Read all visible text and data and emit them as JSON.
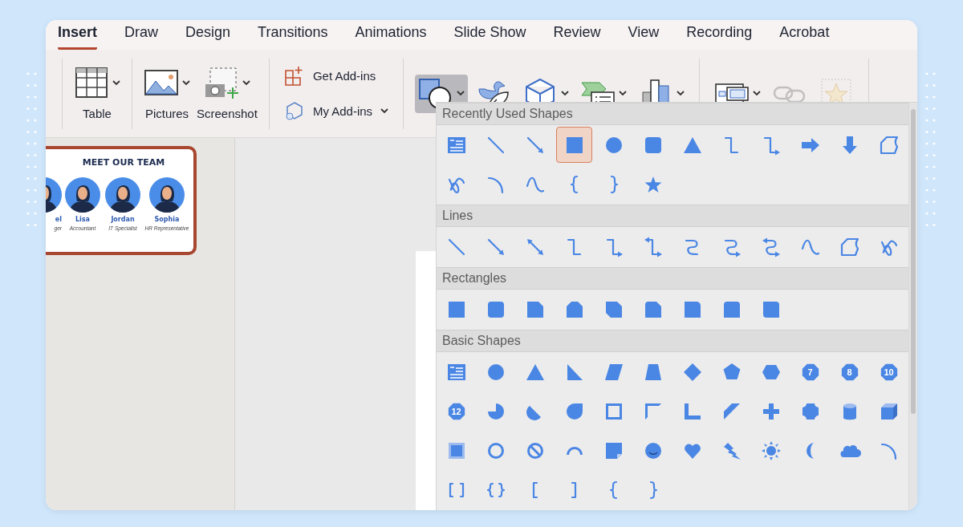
{
  "tabs": [
    {
      "label": "Insert",
      "selected": true
    },
    {
      "label": "Draw",
      "selected": false
    },
    {
      "label": "Design",
      "selected": false
    },
    {
      "label": "Transitions",
      "selected": false
    },
    {
      "label": "Animations",
      "selected": false
    },
    {
      "label": "Slide Show",
      "selected": false
    },
    {
      "label": "Review",
      "selected": false
    },
    {
      "label": "View",
      "selected": false
    },
    {
      "label": "Recording",
      "selected": false
    },
    {
      "label": "Acrobat",
      "selected": false
    }
  ],
  "ribbon": {
    "media_buttons": [
      {
        "kind": "table",
        "label": "Table",
        "menu": true
      },
      {
        "kind": "pictures",
        "label": "Pictures",
        "menu": true
      },
      {
        "kind": "screenshot",
        "label": "Screenshot",
        "menu": true
      }
    ],
    "addins": [
      {
        "kind": "get-addins",
        "label": "Get Add-ins",
        "menu": false
      },
      {
        "kind": "my-addins",
        "label": "My Add-ins",
        "menu": true
      }
    ],
    "tools": [
      {
        "kind": "shapes",
        "menu": true,
        "pressed": true,
        "disabled": false
      },
      {
        "kind": "icons",
        "menu": false,
        "pressed": false,
        "disabled": false
      },
      {
        "kind": "cube",
        "menu": true,
        "pressed": false,
        "disabled": false
      },
      {
        "kind": "smartart",
        "menu": true,
        "pressed": false,
        "disabled": false
      },
      {
        "kind": "chart",
        "menu": true,
        "pressed": false,
        "disabled": false
      }
    ],
    "links": [
      {
        "kind": "video",
        "menu": true,
        "pressed": false,
        "disabled": false
      },
      {
        "kind": "link",
        "menu": false,
        "pressed": false,
        "disabled": true
      },
      {
        "kind": "action",
        "menu": false,
        "pressed": false,
        "disabled": true
      }
    ]
  },
  "slide_thumbnail": {
    "selected": true,
    "title": "MEET OUR TEAM",
    "members": [
      {
        "name": "el",
        "role": "ger"
      },
      {
        "name": "Lisa",
        "role": "Accountant"
      },
      {
        "name": "Jordan",
        "role": "IT Specialist"
      },
      {
        "name": "Sophia",
        "role": "HR Representative"
      }
    ]
  },
  "shapes_menu": {
    "sections": [
      {
        "title": "Recently Used Shapes",
        "shapes": [
          {
            "kind": "textbox",
            "selected": false
          },
          {
            "kind": "line",
            "selected": false
          },
          {
            "kind": "arrow-line",
            "selected": false
          },
          {
            "kind": "rectangle",
            "selected": true
          },
          {
            "kind": "oval",
            "selected": false
          },
          {
            "kind": "rounded-rect",
            "selected": false
          },
          {
            "kind": "triangle",
            "selected": false
          },
          {
            "kind": "elbow",
            "selected": false
          },
          {
            "kind": "elbow-arrow",
            "selected": false
          },
          {
            "kind": "right-arrow",
            "selected": false
          },
          {
            "kind": "down-arrow",
            "selected": false
          },
          {
            "kind": "freeform",
            "selected": false
          },
          {
            "kind": "scribble",
            "selected": false
          },
          {
            "kind": "arc",
            "selected": false
          },
          {
            "kind": "curve",
            "selected": false
          },
          {
            "kind": "left-brace",
            "selected": false
          },
          {
            "kind": "right-brace",
            "selected": false
          },
          {
            "kind": "star",
            "selected": false
          }
        ]
      },
      {
        "title": "Lines",
        "shapes": [
          {
            "kind": "line",
            "selected": false
          },
          {
            "kind": "arrow-line",
            "selected": false
          },
          {
            "kind": "double-arrow",
            "selected": false
          },
          {
            "kind": "elbow",
            "selected": false
          },
          {
            "kind": "elbow-arrow",
            "selected": false
          },
          {
            "kind": "elbow-double",
            "selected": false
          },
          {
            "kind": "s-curve",
            "selected": false
          },
          {
            "kind": "s-curve-arrow",
            "selected": false
          },
          {
            "kind": "s-curve-double",
            "selected": false
          },
          {
            "kind": "curve",
            "selected": false
          },
          {
            "kind": "freeform",
            "selected": false
          },
          {
            "kind": "scribble",
            "selected": false
          }
        ]
      },
      {
        "title": "Rectangles",
        "shapes": [
          {
            "kind": "rectangle",
            "selected": false
          },
          {
            "kind": "rounded-rect",
            "selected": false
          },
          {
            "kind": "snip-one",
            "selected": false
          },
          {
            "kind": "snip-same",
            "selected": false
          },
          {
            "kind": "snip-diagonal",
            "selected": false
          },
          {
            "kind": "snip-round",
            "selected": false
          },
          {
            "kind": "round-one",
            "selected": false
          },
          {
            "kind": "round-same",
            "selected": false
          },
          {
            "kind": "round-diagonal",
            "selected": false
          }
        ]
      },
      {
        "title": "Basic Shapes",
        "shapes": [
          {
            "kind": "textbox",
            "selected": false
          },
          {
            "kind": "oval",
            "selected": false
          },
          {
            "kind": "triangle",
            "selected": false
          },
          {
            "kind": "right-triangle",
            "selected": false
          },
          {
            "kind": "parallelogram",
            "selected": false
          },
          {
            "kind": "trapezoid",
            "selected": false
          },
          {
            "kind": "diamond",
            "selected": false
          },
          {
            "kind": "pentagon",
            "selected": false
          },
          {
            "kind": "hexagon",
            "selected": false
          },
          {
            "kind": "polygon",
            "label": "7",
            "selected": false
          },
          {
            "kind": "polygon",
            "label": "8",
            "selected": false
          },
          {
            "kind": "polygon",
            "label": "10",
            "selected": false
          },
          {
            "kind": "polygon",
            "label": "12",
            "selected": false
          },
          {
            "kind": "pie",
            "selected": false
          },
          {
            "kind": "chord",
            "selected": false
          },
          {
            "kind": "teardrop",
            "selected": false
          },
          {
            "kind": "frame",
            "selected": false
          },
          {
            "kind": "half-frame",
            "selected": false
          },
          {
            "kind": "l-shape",
            "selected": false
          },
          {
            "kind": "diagonal-stripe",
            "selected": false
          },
          {
            "kind": "plus",
            "selected": false
          },
          {
            "kind": "plaque",
            "selected": false
          },
          {
            "kind": "can",
            "selected": false
          },
          {
            "kind": "cube",
            "selected": false
          },
          {
            "kind": "bevel",
            "selected": false
          },
          {
            "kind": "donut",
            "selected": false
          },
          {
            "kind": "no-symbol",
            "selected": false
          },
          {
            "kind": "block-arc",
            "selected": false
          },
          {
            "kind": "folded-corner",
            "selected": false
          },
          {
            "kind": "smiley",
            "selected": false
          },
          {
            "kind": "heart",
            "selected": false
          },
          {
            "kind": "lightning",
            "selected": false
          },
          {
            "kind": "sun",
            "selected": false
          },
          {
            "kind": "moon",
            "selected": false
          },
          {
            "kind": "cloud",
            "selected": false
          },
          {
            "kind": "arc",
            "selected": false
          },
          {
            "kind": "bracket-pair",
            "selected": false
          },
          {
            "kind": "brace-pair",
            "selected": false
          },
          {
            "kind": "left-bracket",
            "selected": false
          },
          {
            "kind": "right-bracket",
            "selected": false
          },
          {
            "kind": "left-brace",
            "selected": false
          },
          {
            "kind": "right-brace",
            "selected": false
          }
        ]
      }
    ]
  }
}
